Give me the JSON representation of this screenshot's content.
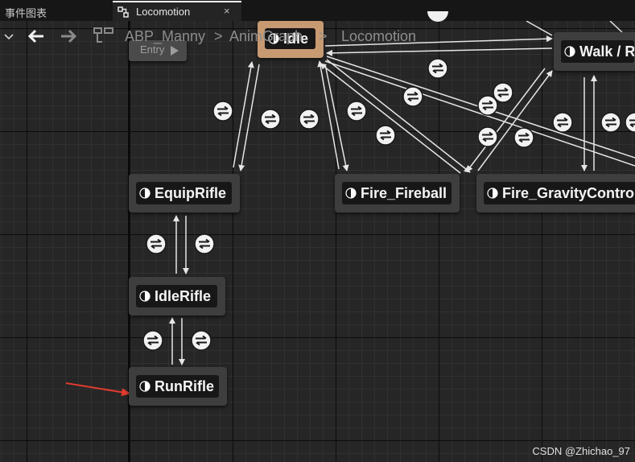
{
  "tabs": {
    "inactive_label": "事件图表",
    "active_label": "Locomotion",
    "close_glyph": "×"
  },
  "toolbar": {
    "breadcrumbs": [
      "ABP_Manny",
      "AnimGraph",
      "Locomotion"
    ],
    "separator": ">"
  },
  "nodes": {
    "entry": "Entry",
    "idle": "Idle",
    "walk": "Walk / R",
    "equip_rifle": "EquipRifle",
    "fire_fireball": "Fire_Fireball",
    "fire_gravity": "Fire_GravityControl",
    "idle_rifle": "IdleRifle",
    "run_rifle": "RunRifle"
  },
  "watermark": "CSDN @Zhichao_97",
  "colors": {
    "node_bg": "#3e3e3e",
    "idle_node_bg": "#c89a72",
    "arrow_annotation": "#e03a2f",
    "transition_arrows": "#e6e6e6"
  },
  "icons": {
    "state": "half-circle-state-icon",
    "transition": "double-arrow-transition-icon"
  }
}
